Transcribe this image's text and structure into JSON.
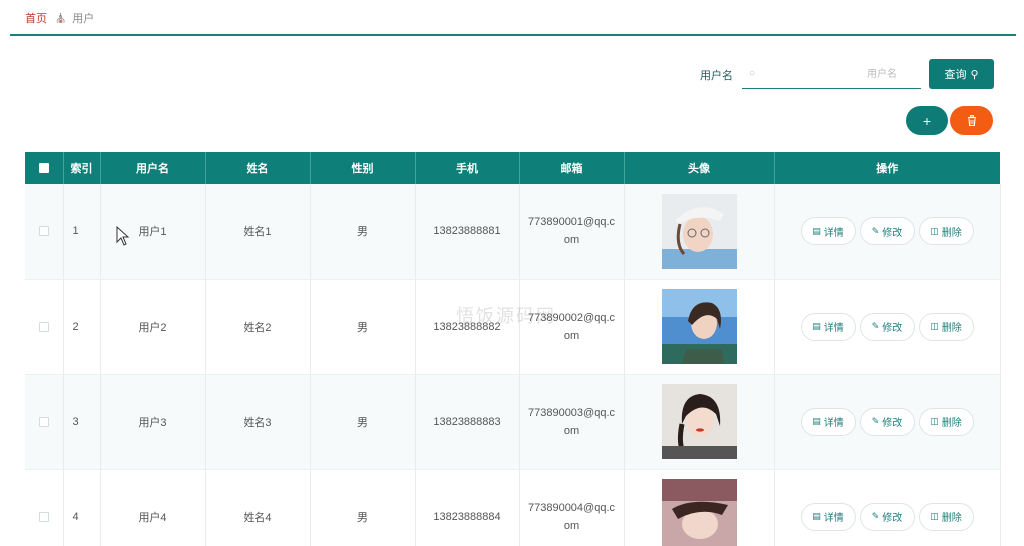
{
  "breadcrumb": {
    "home": "首页",
    "current": "用户"
  },
  "search": {
    "label": "用户名",
    "placeholder": "用户名",
    "button_label": "查询"
  },
  "actions": {
    "add_icon": "+",
    "delete_icon": "trash-icon"
  },
  "table": {
    "columns": [
      "索引",
      "用户名",
      "姓名",
      "性别",
      "手机",
      "邮箱",
      "头像",
      "操作"
    ],
    "rows": [
      {
        "index": "1",
        "username": "用户1",
        "name": "姓名1",
        "gender": "男",
        "phone": "13823888881",
        "email": "773890001@qq.com"
      },
      {
        "index": "2",
        "username": "用户2",
        "name": "姓名2",
        "gender": "男",
        "phone": "13823888882",
        "email": "773890002@qq.com"
      },
      {
        "index": "3",
        "username": "用户3",
        "name": "姓名3",
        "gender": "男",
        "phone": "13823888883",
        "email": "773890003@qq.com"
      },
      {
        "index": "4",
        "username": "用户4",
        "name": "姓名4",
        "gender": "男",
        "phone": "13823888884",
        "email": "773890004@qq.com"
      }
    ],
    "row_actions": {
      "detail": "详情",
      "edit": "修改",
      "delete": "删除"
    }
  },
  "watermark": "悟饭源码网",
  "colors": {
    "primary": "#0e7b76",
    "danger": "#f35c13",
    "breadcrumb_home": "#c0392b"
  }
}
